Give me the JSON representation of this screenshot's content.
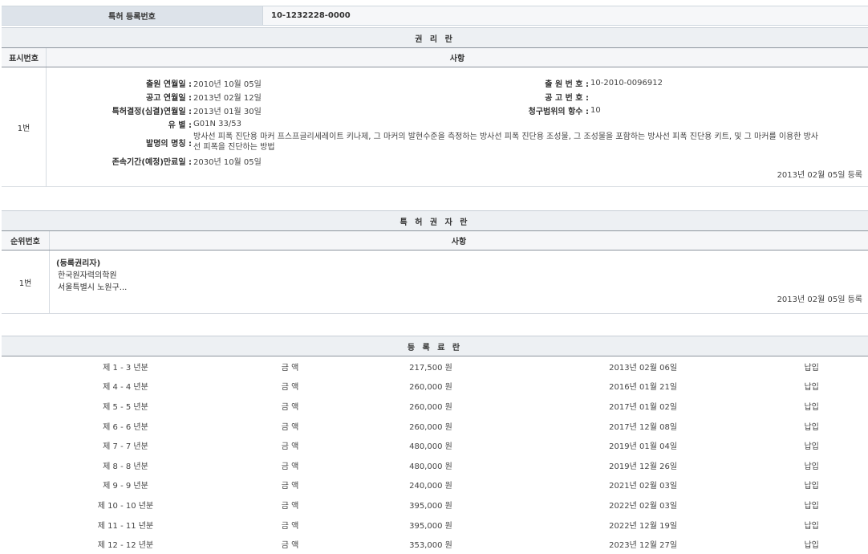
{
  "reg": {
    "label": "특허 등록번호",
    "value": "10-1232228-0000"
  },
  "rights": {
    "title": "권 리 란",
    "col_no": "표시번호",
    "col_content": "사항",
    "row_no": "1번",
    "left": [
      {
        "k": "출원 연월일 :",
        "v": "2010년 10월 05일"
      },
      {
        "k": "공고 연월일 :",
        "v": "2013년 02월 12일"
      },
      {
        "k": "특허결정(심결)연월일 :",
        "v": "2013년 01월 30일"
      },
      {
        "k": "유 별 :",
        "v": "G01N 33/53"
      }
    ],
    "right": [
      {
        "k": "출 원 번 호 :",
        "v": "10-2010-0096912"
      },
      {
        "k": "공 고 번 호 :",
        "v": ""
      },
      {
        "k": "청구범위의 항수 :",
        "v": "10"
      }
    ],
    "invention_key": "발명의 명칭 :",
    "invention_line1": "방사선 피폭 진단용 마커 프스프글리세레이트 키나제, 그 마커의 발현수준을 측정하는 방사선 피폭 진단용 조성물, 그 조성물을 포함하는 방사선 피폭 진단용 키트, 및 그 마커를 이용한 방사",
    "invention_line2": "선 피폭을 진단하는 방법",
    "expiry_key": "존속기간(예정)만료일 :",
    "expiry_value": "2030년 10월 05일",
    "stamp": "2013년 02월 05일 등록"
  },
  "owners": {
    "title": "특 허 권 자 란",
    "col_no": "순위번호",
    "col_content": "사항",
    "row_no": "1번",
    "role": "(등록권리자)",
    "name": "한국원자력의학원",
    "address": "서울특별시 노원구...",
    "stamp": "2013년 02월 05일 등록"
  },
  "fees": {
    "title": "등 록 료 란",
    "rows": [
      {
        "period": "제 1 - 3 년분",
        "label": "금 액",
        "amount": "217,500 원",
        "date": "2013년 02월 06일",
        "status": "납입"
      },
      {
        "period": "제 4 - 4 년분",
        "label": "금 액",
        "amount": "260,000 원",
        "date": "2016년 01월 21일",
        "status": "납입"
      },
      {
        "period": "제 5 - 5 년분",
        "label": "금 액",
        "amount": "260,000 원",
        "date": "2017년 01월 02일",
        "status": "납입"
      },
      {
        "period": "제 6 - 6 년분",
        "label": "금 액",
        "amount": "260,000 원",
        "date": "2017년 12월 08일",
        "status": "납입"
      },
      {
        "period": "제 7 - 7 년분",
        "label": "금 액",
        "amount": "480,000 원",
        "date": "2019년 01월 04일",
        "status": "납입"
      },
      {
        "period": "제 8 - 8 년분",
        "label": "금 액",
        "amount": "480,000 원",
        "date": "2019년 12월 26일",
        "status": "납입"
      },
      {
        "period": "제 9 - 9 년분",
        "label": "금 액",
        "amount": "240,000 원",
        "date": "2021년 02월 03일",
        "status": "납입"
      },
      {
        "period": "제 10 - 10 년분",
        "label": "금 액",
        "amount": "395,000 원",
        "date": "2022년 02월 03일",
        "status": "납입"
      },
      {
        "period": "제 11 - 11 년분",
        "label": "금 액",
        "amount": "395,000 원",
        "date": "2022년 12월 19일",
        "status": "납입"
      },
      {
        "period": "제 12 - 12 년분",
        "label": "금 액",
        "amount": "353,000 원",
        "date": "2023년 12월 27일",
        "status": "납입"
      }
    ]
  }
}
